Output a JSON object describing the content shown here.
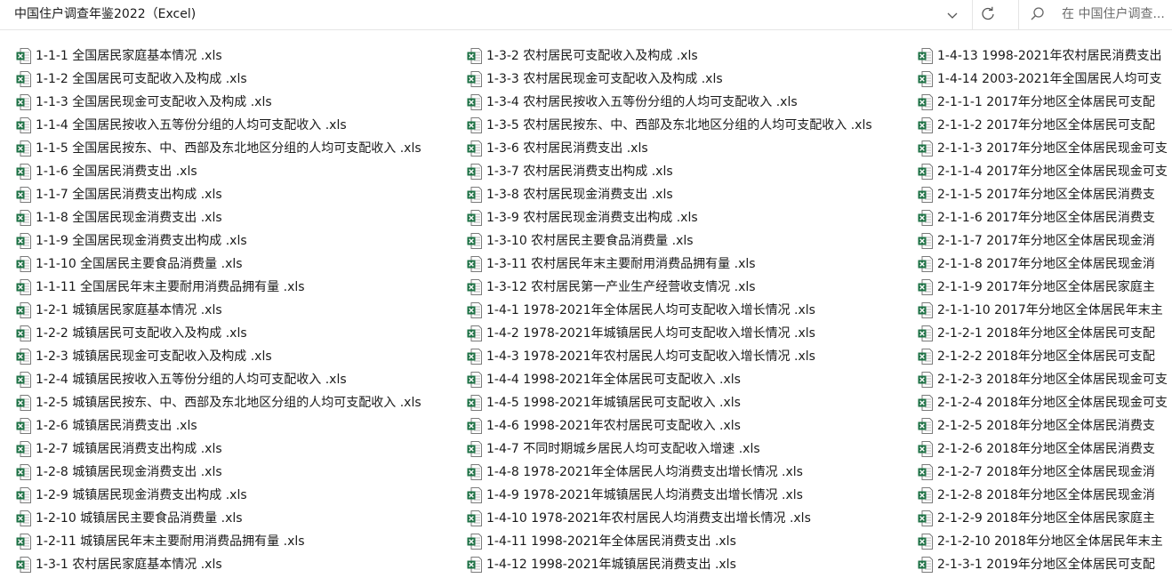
{
  "address": {
    "path": "中国住户调查年鉴2022（Excel)",
    "search_placeholder": "在 中国住户调查..."
  },
  "icons": {
    "dropdown": "chevron-down-icon",
    "refresh": "refresh-icon",
    "search": "search-icon",
    "file": "excel-file-icon"
  },
  "colors": {
    "excel_green": "#1e7145",
    "excel_bg": "#ffffff"
  },
  "columns": [
    {
      "files": [
        "1-1-1 全国居民家庭基本情况 .xls",
        "1-1-2 全国居民可支配收入及构成 .xls",
        "1-1-3 全国居民现金可支配收入及构成 .xls",
        "1-1-4 全国居民按收入五等份分组的人均可支配收入 .xls",
        "1-1-5 全国居民按东、中、西部及东北地区分组的人均可支配收入 .xls",
        "1-1-6 全国居民消费支出 .xls",
        "1-1-7 全国居民消费支出构成 .xls",
        "1-1-8 全国居民现金消费支出 .xls",
        "1-1-9 全国居民现金消费支出构成 .xls",
        "1-1-10 全国居民主要食品消费量 .xls",
        "1-1-11 全国居民年末主要耐用消费品拥有量 .xls",
        "1-2-1 城镇居民家庭基本情况 .xls",
        "1-2-2 城镇居民可支配收入及构成 .xls",
        "1-2-3 城镇居民现金可支配收入及构成 .xls",
        "1-2-4 城镇居民按收入五等份分组的人均可支配收入 .xls",
        "1-2-5 城镇居民按东、中、西部及东北地区分组的人均可支配收入 .xls",
        "1-2-6 城镇居民消费支出 .xls",
        "1-2-7 城镇居民消费支出构成 .xls",
        "1-2-8 城镇居民现金消费支出 .xls",
        "1-2-9 城镇居民现金消费支出构成 .xls",
        "1-2-10 城镇居民主要食品消费量 .xls",
        "1-2-11 城镇居民年末主要耐用消费品拥有量 .xls",
        "1-3-1 农村居民家庭基本情况 .xls"
      ]
    },
    {
      "files": [
        "1-3-2 农村居民可支配收入及构成 .xls",
        "1-3-3 农村居民现金可支配收入及构成 .xls",
        "1-3-4 农村居民按收入五等份分组的人均可支配收入 .xls",
        "1-3-5 农村居民按东、中、西部及东北地区分组的人均可支配收入 .xls",
        "1-3-6 农村居民消费支出 .xls",
        "1-3-7 农村居民消费支出构成 .xls",
        "1-3-8 农村居民现金消费支出 .xls",
        "1-3-9 农村居民现金消费支出构成 .xls",
        "1-3-10 农村居民主要食品消费量 .xls",
        "1-3-11 农村居民年末主要耐用消费品拥有量 .xls",
        "1-3-12 农村居民第一产业生产经营收支情况 .xls",
        "1-4-1 1978-2021年全体居民人均可支配收入增长情况 .xls",
        "1-4-2 1978-2021年城镇居民人均可支配收入增长情况 .xls",
        "1-4-3 1978-2021年农村居民人均可支配收入增长情况 .xls",
        "1-4-4 1998-2021年全体居民可支配收入 .xls",
        "1-4-5 1998-2021年城镇居民可支配收入 .xls",
        "1-4-6 1998-2021年农村居民可支配收入 .xls",
        "1-4-7 不同时期城乡居民人均可支配收入增速 .xls",
        "1-4-8 1978-2021年全体居民人均消费支出增长情况 .xls",
        "1-4-9 1978-2021年城镇居民人均消费支出增长情况 .xls",
        "1-4-10 1978-2021年农村居民人均消费支出增长情况 .xls",
        "1-4-11 1998-2021年全体居民消费支出 .xls",
        "1-4-12 1998-2021年城镇居民消费支出 .xls"
      ]
    },
    {
      "files": [
        "1-4-13 1998-2021年农村居民消费支出",
        "1-4-14 2003-2021年全国居民人均可支",
        "2-1-1-1 2017年分地区全体居民可支配",
        "2-1-1-2 2017年分地区全体居民可支配",
        "2-1-1-3 2017年分地区全体居民现金可支",
        "2-1-1-4 2017年分地区全体居民现金可支",
        "2-1-1-5 2017年分地区全体居民消费支",
        "2-1-1-6 2017年分地区全体居民消费支",
        "2-1-1-7 2017年分地区全体居民现金消",
        "2-1-1-8 2017年分地区全体居民现金消",
        "2-1-1-9 2017年分地区全体居民家庭主",
        "2-1-1-10 2017年分地区全体居民年末主",
        "2-1-2-1 2018年分地区全体居民可支配",
        "2-1-2-2 2018年分地区全体居民可支配",
        "2-1-2-3 2018年分地区全体居民现金可支",
        "2-1-2-4 2018年分地区全体居民现金可支",
        "2-1-2-5 2018年分地区全体居民消费支",
        "2-1-2-6 2018年分地区全体居民消费支",
        "2-1-2-7 2018年分地区全体居民现金消",
        "2-1-2-8 2018年分地区全体居民现金消",
        "2-1-2-9 2018年分地区全体居民家庭主",
        "2-1-2-10 2018年分地区全体居民年末主",
        "2-1-3-1 2019年分地区全体居民可支配"
      ]
    }
  ]
}
